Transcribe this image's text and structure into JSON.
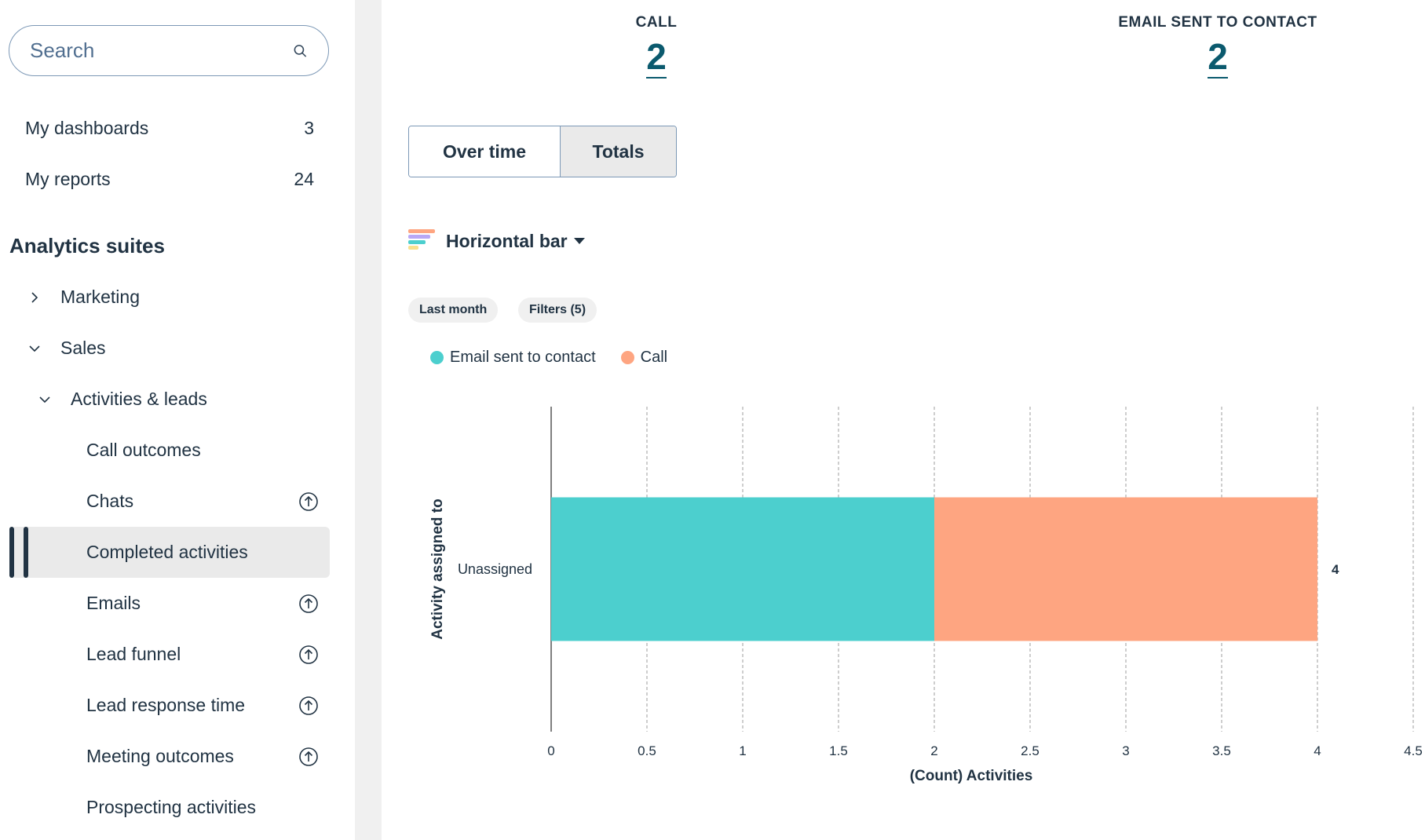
{
  "sidebar": {
    "search_placeholder": "Search",
    "top_items": [
      {
        "label": "My dashboards",
        "count": "3"
      },
      {
        "label": "My reports",
        "count": "24"
      }
    ],
    "section_title": "Analytics suites",
    "tree": {
      "marketing": "Marketing",
      "sales": "Sales",
      "activities": "Activities & leads"
    },
    "reports": [
      {
        "label": "Call outcomes"
      },
      {
        "label": "Chats"
      },
      {
        "label": "Completed activities"
      },
      {
        "label": "Emails"
      },
      {
        "label": "Lead funnel"
      },
      {
        "label": "Lead response time"
      },
      {
        "label": "Meeting outcomes"
      },
      {
        "label": "Prospecting activities"
      }
    ]
  },
  "kpis": [
    {
      "label": "CALL",
      "value": "2"
    },
    {
      "label": "EMAIL SENT TO CONTACT",
      "value": "2"
    }
  ],
  "view_toggle": {
    "over_time": "Over time",
    "totals": "Totals",
    "selected": "Totals"
  },
  "chart_type_label": "Horizontal bar",
  "chips": {
    "date": "Last month",
    "filters": "Filters (5)"
  },
  "colors": {
    "email": "#4ccfce",
    "call": "#fea581",
    "accent": "#0b5a6e"
  },
  "chart_data": {
    "type": "bar",
    "orientation": "horizontal",
    "stacked": true,
    "categories": [
      "Unassigned"
    ],
    "series": [
      {
        "name": "Email sent to contact",
        "values": [
          2
        ]
      },
      {
        "name": "Call",
        "values": [
          2
        ]
      }
    ],
    "totals": [
      "4"
    ],
    "xlabel": "(Count) Activities",
    "ylabel": "Activity assigned to",
    "xlim": [
      0,
      4.5
    ],
    "xticks": [
      "0",
      "0.5",
      "1",
      "1.5",
      "2",
      "2.5",
      "3",
      "3.5",
      "4",
      "4.5"
    ],
    "grid": true,
    "legend": "top-left"
  }
}
